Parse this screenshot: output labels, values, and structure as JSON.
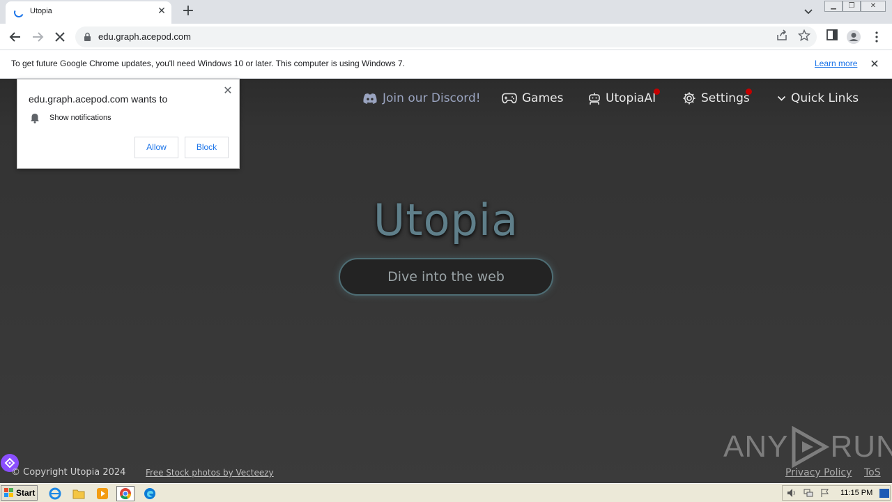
{
  "browser": {
    "tab_title": "Utopia",
    "url": "edu.graph.acepod.com",
    "info_bar": {
      "message": "To get future Google Chrome updates, you'll need Windows 10 or later. This computer is using Windows 7.",
      "link": "Learn more"
    }
  },
  "permission_popup": {
    "title": "edu.graph.acepod.com wants to",
    "permission": "Show notifications",
    "allow_label": "Allow",
    "block_label": "Block"
  },
  "site": {
    "nav": {
      "discord": "Join our Discord!",
      "games": "Games",
      "ai": "UtopiaAI",
      "settings": "Settings",
      "quick_links": "Quick Links"
    },
    "hero_title": "Utopia",
    "hero_button": "Dive into the web",
    "footer": {
      "copyright": "© Copyright Utopia 2024",
      "credit_link": "Free Stock photos by Vecteezy",
      "privacy": "Privacy Policy",
      "tos": "ToS"
    },
    "notification_dot_color": "#c40000",
    "accent_color": "#5f7f8a"
  },
  "watermark": {
    "left": "ANY",
    "right": "RUN"
  },
  "taskbar": {
    "start_label": "Start",
    "clock": "11:15 PM"
  }
}
